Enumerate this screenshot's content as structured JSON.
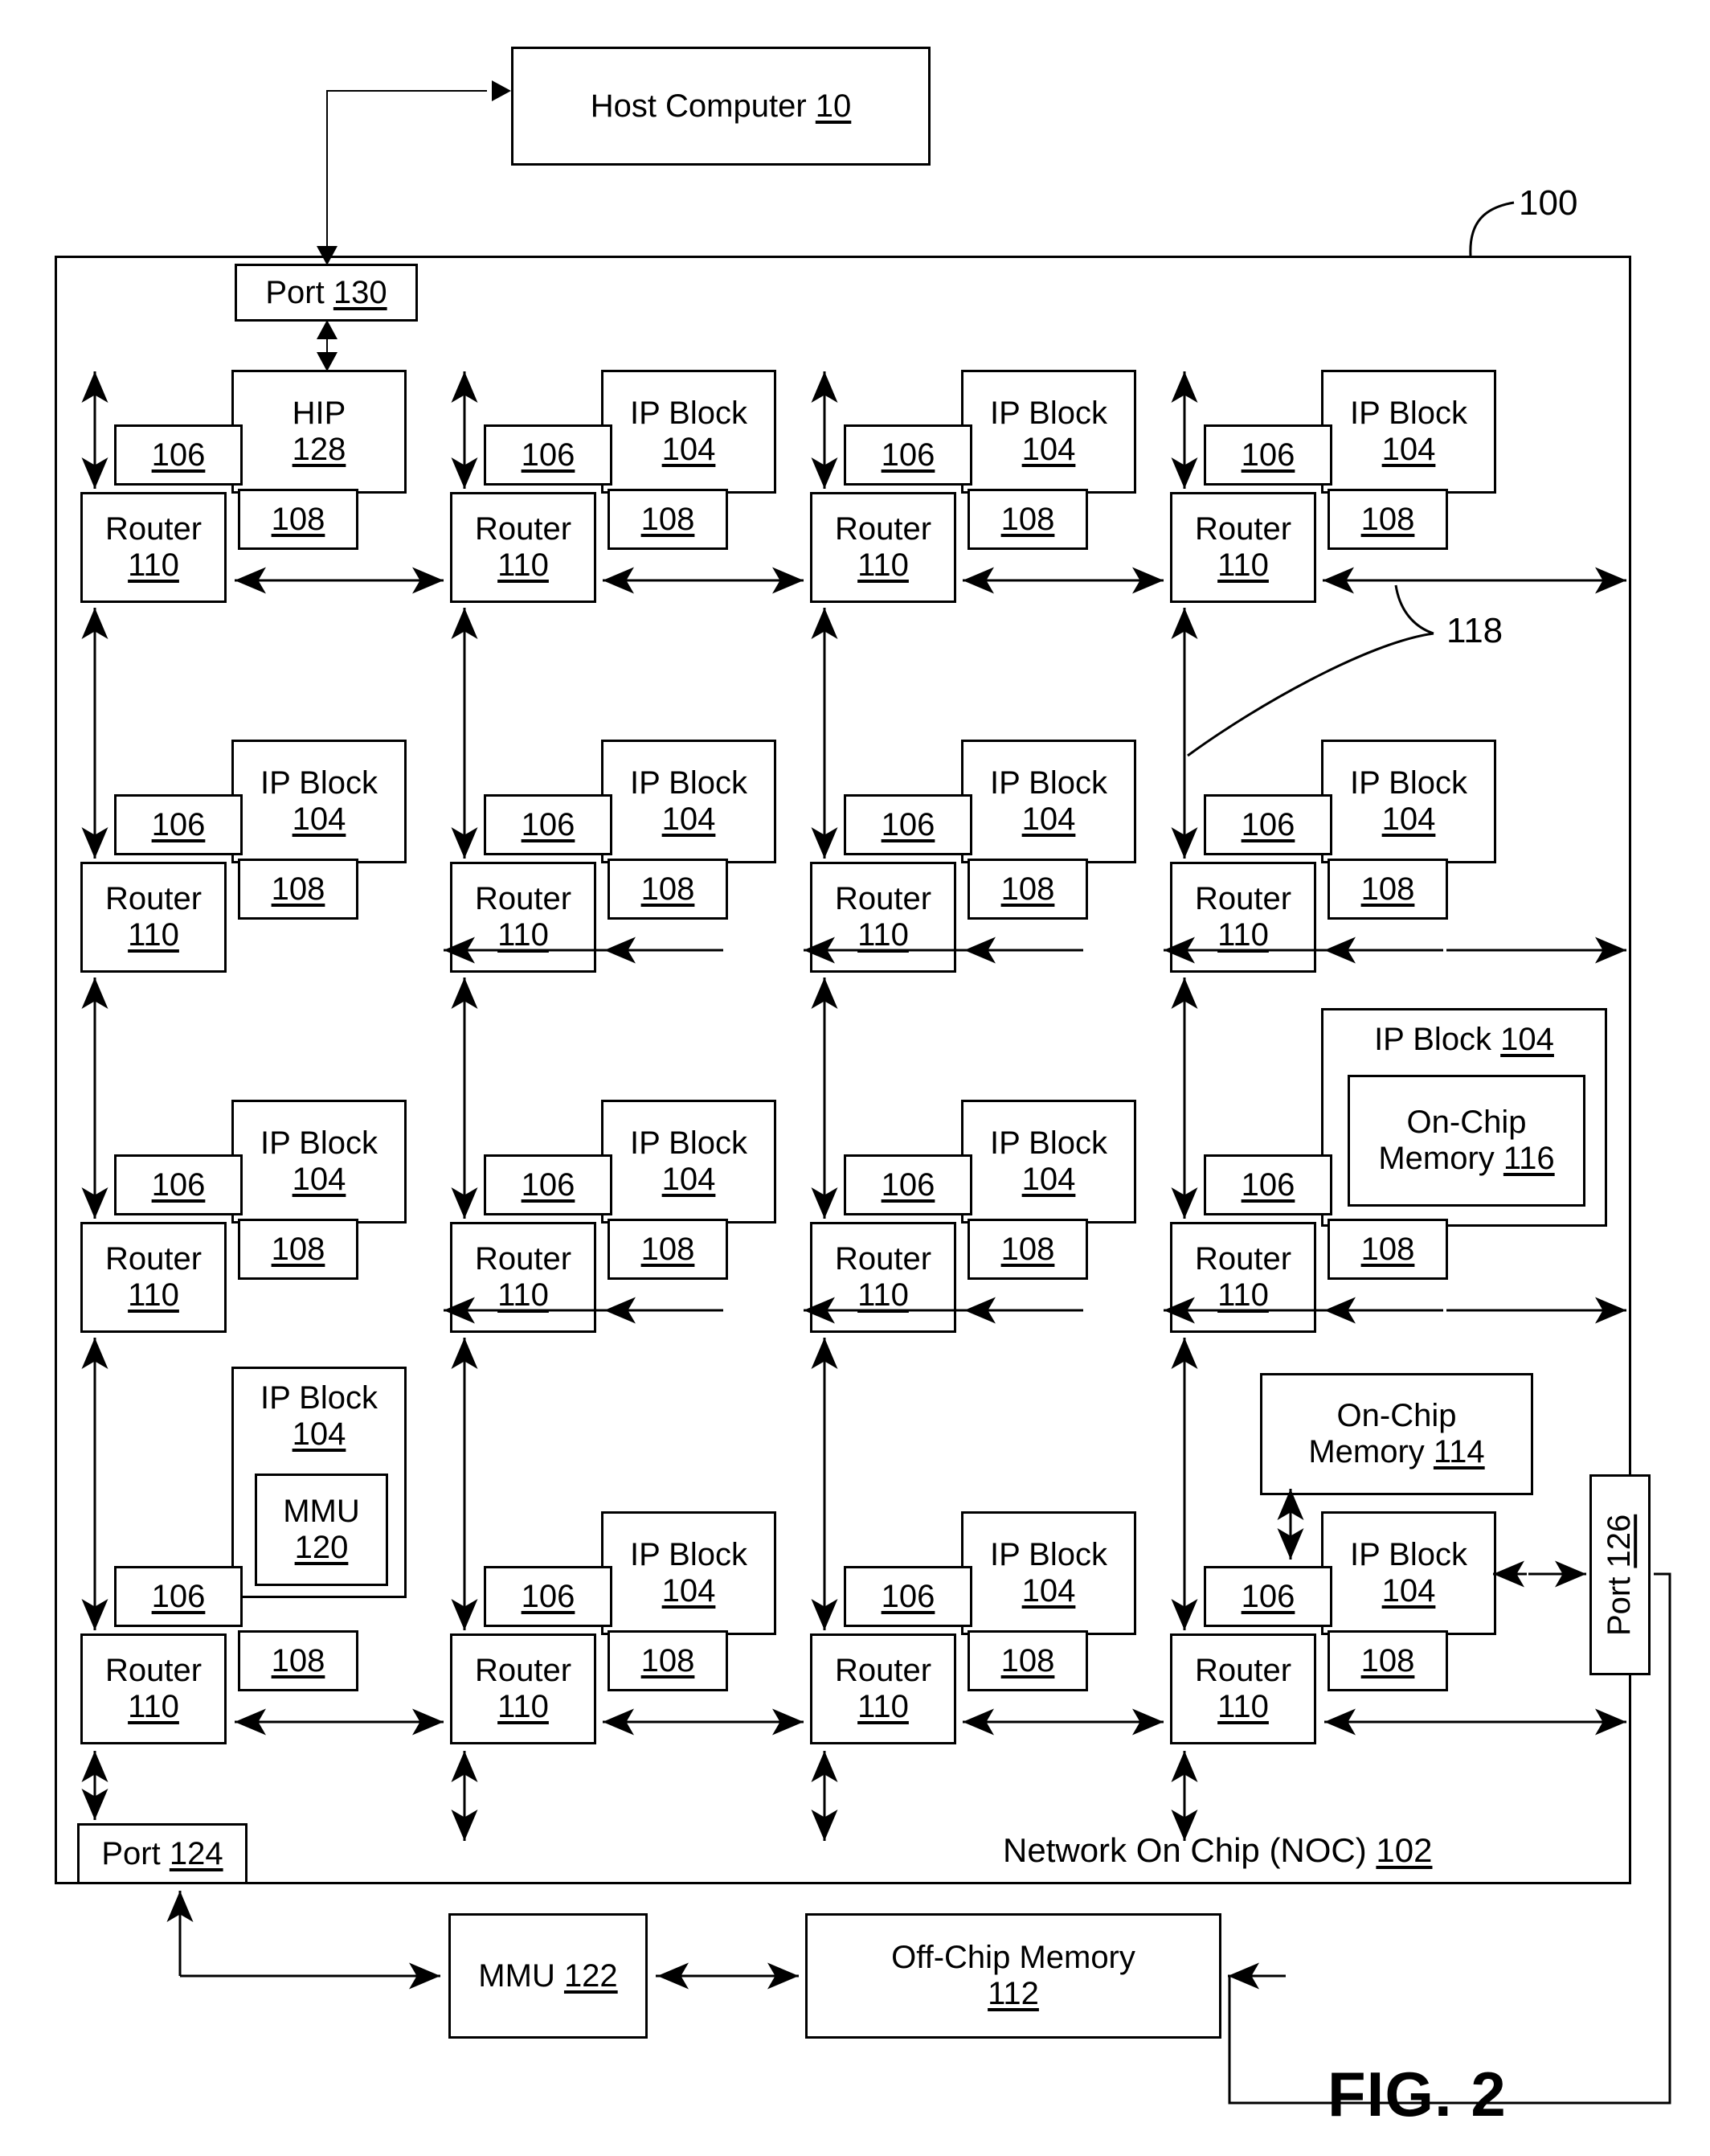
{
  "figure": {
    "label": "FIG. 2",
    "system_ref": "100",
    "link_ref": "118"
  },
  "host": {
    "label": "Host Computer ",
    "ref": "10"
  },
  "ports": {
    "top": {
      "label": "Port ",
      "ref": "130"
    },
    "bottom_left": {
      "label": "Port ",
      "ref": "124"
    },
    "right": {
      "label": "Port ",
      "ref": "126"
    }
  },
  "noc": {
    "title": "Network On Chip (NOC) ",
    "ref": "102"
  },
  "external": {
    "mmu": {
      "label": "MMU ",
      "ref": "122"
    },
    "offchip": {
      "line1": "Off-Chip  Memory",
      "ref": "112"
    }
  },
  "tile_parts": {
    "ip_block": "IP Block",
    "ip_ref": "104",
    "hip": "HIP",
    "hip_ref": "128",
    "router": "Router",
    "router_ref": "110",
    "link_106": "106",
    "link_108": "108"
  },
  "special_blocks": {
    "onchip_116": {
      "line1": "On-Chip",
      "line2": "Memory ",
      "ref": "116",
      "parent": "IP Block ",
      "parent_ref": "104"
    },
    "onchip_114": {
      "line1": "On-Chip",
      "line2": "Memory ",
      "ref": "114"
    },
    "mmu_120": {
      "label": "MMU",
      "ref": "120"
    }
  },
  "grid": {
    "rows": 4,
    "cols": 4,
    "tiles": [
      [
        {
          "type": "hip",
          "name": "HIP",
          "ref": "128"
        },
        {
          "type": "ip",
          "name": "IP Block",
          "ref": "104"
        },
        {
          "type": "ip",
          "name": "IP Block",
          "ref": "104"
        },
        {
          "type": "ip",
          "name": "IP Block",
          "ref": "104"
        }
      ],
      [
        {
          "type": "ip",
          "name": "IP Block",
          "ref": "104"
        },
        {
          "type": "ip",
          "name": "IP Block",
          "ref": "104"
        },
        {
          "type": "ip",
          "name": "IP Block",
          "ref": "104"
        },
        {
          "type": "ip",
          "name": "IP Block",
          "ref": "104"
        }
      ],
      [
        {
          "type": "ip",
          "name": "IP Block",
          "ref": "104"
        },
        {
          "type": "ip",
          "name": "IP Block",
          "ref": "104"
        },
        {
          "type": "ip",
          "name": "IP Block",
          "ref": "104"
        },
        {
          "type": "ip-memory",
          "name": "IP Block ",
          "ref": "104",
          "inner": "On-Chip Memory 116"
        }
      ],
      [
        {
          "type": "ip-mmu",
          "name": "IP Block",
          "ref": "104",
          "inner": "MMU 120"
        },
        {
          "type": "ip",
          "name": "IP Block",
          "ref": "104"
        },
        {
          "type": "ip",
          "name": "IP Block",
          "ref": "104"
        },
        {
          "type": "ip",
          "name": "IP Block",
          "ref": "104"
        }
      ]
    ]
  }
}
